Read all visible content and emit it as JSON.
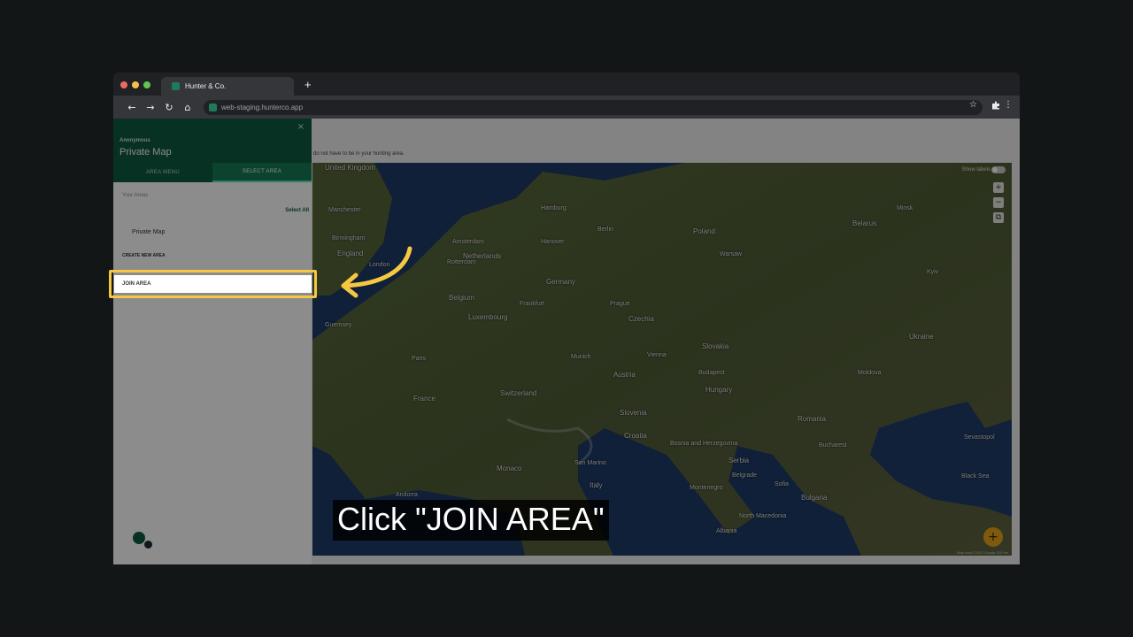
{
  "browser": {
    "tab_title": "Hunter & Co.",
    "new_tab": "+",
    "url": "web-staging.hunterco.app",
    "icons": [
      "back-icon",
      "forward-icon",
      "reload-icon",
      "home-icon",
      "star-icon",
      "extensions-icon",
      "menu-icon"
    ]
  },
  "sidebar": {
    "close": "×",
    "owner": "Anonymous",
    "title": "Private Map",
    "tabs": [
      {
        "label": "AREA MENU",
        "active": false
      },
      {
        "label": "SELECT AREA",
        "active": true
      }
    ],
    "areas_label": "Your Areas",
    "select_all": "Select All",
    "areas": [
      {
        "label": "Private Map"
      }
    ],
    "create_new": "CREATE NEW AREA",
    "join_area": "JOIN AREA"
  },
  "page": {
    "hint": "do not have to be in your hunting area."
  },
  "map": {
    "show_labels": "Show labels",
    "zoom_in": "+",
    "zoom_out": "−",
    "layers": "⧉",
    "fab": "+",
    "attribution": "Map data ©2022 Google  200 km",
    "labels": [
      "United Kingdom",
      "Manchester",
      "Birmingham",
      "England",
      "London",
      "Amsterdam",
      "Netherlands",
      "Rotterdam",
      "Belgium",
      "Luxembourg",
      "Hamburg",
      "Berlin",
      "Germany",
      "Hanover",
      "Frankfurt",
      "Munich",
      "Poland",
      "Warsaw",
      "Belarus",
      "Minsk",
      "Czechia",
      "Prague",
      "Slovakia",
      "Austria",
      "Vienna",
      "Hungary",
      "Budapest",
      "Ukraine",
      "Kyiv",
      "Moldova",
      "Romania",
      "Bucharest",
      "France",
      "Paris",
      "Switzerland",
      "Slovenia",
      "Croatia",
      "Bosnia and Herzegovina",
      "Serbia",
      "Belgrade",
      "Bulgaria",
      "Sofia",
      "Italy",
      "Monaco",
      "San Marino",
      "Montenegro",
      "North Macedonia",
      "Albania",
      "Andorra",
      "Guernsey",
      "Sevastopol",
      "Black Sea"
    ]
  },
  "tutorial": {
    "caption": "Click \"JOIN AREA\"",
    "highlight_color": "#f6c842"
  },
  "colors": {
    "brand": "#0e5a41",
    "brand_tab_active": "#177a57",
    "fab": "#e6a21a"
  }
}
